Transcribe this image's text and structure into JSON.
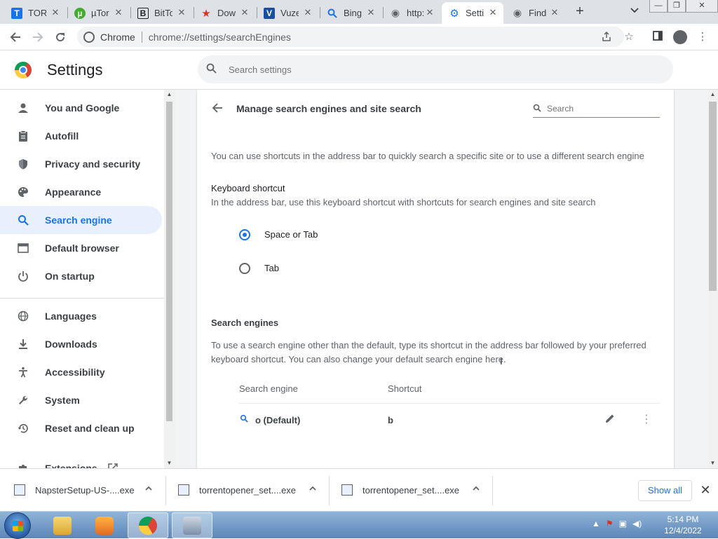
{
  "tabs": [
    {
      "title": "TORi",
      "favicon": "T",
      "favicon_color": "#1a73e8",
      "close": "✕"
    },
    {
      "title": "µTor",
      "favicon": "µ",
      "favicon_color": "#3fae2a",
      "close": "✕"
    },
    {
      "title": "BitTo",
      "favicon": "B",
      "favicon_color": "#202124",
      "close": "✕"
    },
    {
      "title": "Dow",
      "favicon": "★",
      "favicon_color": "#d93025",
      "close": "✕"
    },
    {
      "title": "Vuze",
      "favicon": "V",
      "favicon_color": "#1a4fa0",
      "close": "✕"
    },
    {
      "title": "Bing",
      "favicon": "🔍",
      "favicon_color": "#1a73e8",
      "close": "✕"
    },
    {
      "title": "http:",
      "favicon": "◉",
      "favicon_color": "#5f6368",
      "close": "✕"
    },
    {
      "title": "Setti",
      "favicon": "⚙",
      "favicon_color": "#1a73e8",
      "close": "✕"
    },
    {
      "title": "Find",
      "favicon": "◉",
      "favicon_color": "#5f6368",
      "close": "✕"
    }
  ],
  "new_tab": "+",
  "window_controls": {
    "minimize": "—",
    "maximize": "❐",
    "close": "✕"
  },
  "address_bar": {
    "site_label": "Chrome",
    "url": "chrome://settings/searchEngines"
  },
  "settings_header": {
    "title": "Settings",
    "search_placeholder": "Search settings"
  },
  "sidebar": {
    "items": [
      {
        "label": "You and Google",
        "icon": "person-icon"
      },
      {
        "label": "Autofill",
        "icon": "clipboard-icon"
      },
      {
        "label": "Privacy and security",
        "icon": "shield-icon"
      },
      {
        "label": "Appearance",
        "icon": "palette-icon"
      },
      {
        "label": "Search engine",
        "icon": "search-icon",
        "active": true
      },
      {
        "label": "Default browser",
        "icon": "browser-icon"
      },
      {
        "label": "On startup",
        "icon": "power-icon"
      },
      {
        "label": "Languages",
        "icon": "globe-icon"
      },
      {
        "label": "Downloads",
        "icon": "download-icon"
      },
      {
        "label": "Accessibility",
        "icon": "accessibility-icon"
      },
      {
        "label": "System",
        "icon": "wrench-icon"
      },
      {
        "label": "Reset and clean up",
        "icon": "history-icon"
      },
      {
        "label": "Extensions",
        "icon": "puzzle-icon"
      }
    ]
  },
  "main": {
    "title": "Manage search engines and site search",
    "search_placeholder": "Search",
    "intro": "You can use shortcuts in the address bar to quickly search a specific site or to use a different search engine",
    "keyboard_shortcut": {
      "heading": "Keyboard shortcut",
      "description": "In the address bar, use this keyboard shortcut with shortcuts for search engines and site search",
      "options": [
        {
          "label": "Space or Tab",
          "checked": true
        },
        {
          "label": "Tab",
          "checked": false
        }
      ]
    },
    "search_engines": {
      "heading": "Search engines",
      "description_line1": "To use a search engine other than the default, type its shortcut in the address bar followed by your preferred",
      "description_line2": "keyboard shortcut. You can also change your default search engine here.",
      "columns": [
        "Search engine",
        "Shortcut"
      ],
      "rows": [
        {
          "name": "o (Default)",
          "shortcut": "b"
        }
      ]
    }
  },
  "downloads": {
    "items": [
      {
        "filename": "NapsterSetup-US-....exe"
      },
      {
        "filename": "torrentopener_set....exe"
      },
      {
        "filename": "torrentopener_set....exe"
      }
    ],
    "show_all": "Show all",
    "close": "✕"
  },
  "taskbar": {
    "time": "5:14 PM",
    "date": "12/4/2022"
  },
  "colors": {
    "accent": "#1a73e8",
    "active_nav_bg": "#e8f0fe"
  }
}
